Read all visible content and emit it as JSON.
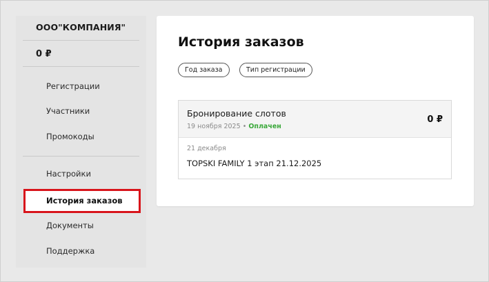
{
  "sidebar": {
    "company": "ООО\"КОМПАНИЯ\"",
    "balance": "0 ₽",
    "items": [
      {
        "label": "Регистрации"
      },
      {
        "label": "Участники"
      },
      {
        "label": "Промокоды"
      },
      {
        "label": "Настройки"
      },
      {
        "label": "История заказов"
      },
      {
        "label": "Документы"
      },
      {
        "label": "Поддержка"
      }
    ]
  },
  "main": {
    "title": "История заказов",
    "filters": [
      {
        "label": "Год заказа"
      },
      {
        "label": "Тип регистрации"
      }
    ],
    "order": {
      "name": "Бронирование слотов",
      "date": "19 ноября 2025",
      "separator": "•",
      "status": "Оплачен",
      "amount": "0 ₽",
      "item_date": "21 декабря",
      "item_title": "TOPSKI FAMILY 1 этап 21.12.2025"
    }
  },
  "colors": {
    "highlight_border": "#d8141b",
    "status_paid": "#3aa83a"
  }
}
